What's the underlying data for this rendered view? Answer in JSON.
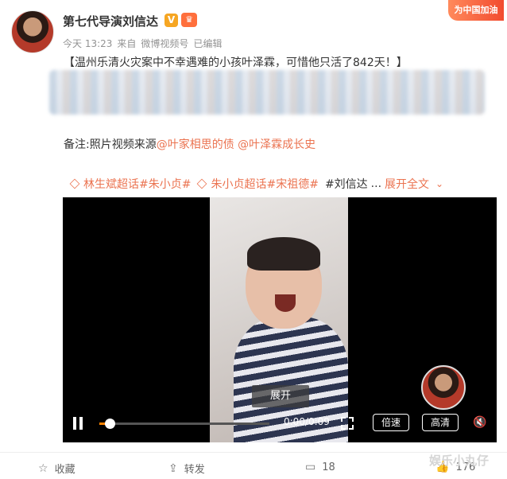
{
  "user": {
    "name": "第七代导演刘信达",
    "verified_badge": "V",
    "meta": [
      "今天 13:23",
      "来自",
      "微博视频号",
      "已编辑"
    ]
  },
  "promo_label": "为中国加油",
  "post": {
    "text": "【温州乐清火灾案中不幸遇难的小孩叶泽霖，可惜他只活了842天！】",
    "note_prefix": "备注:照片视频来源",
    "mention1": "@叶家相思的债",
    "mention2": "@叶泽霖成长史"
  },
  "tags": {
    "tag1": "林生斌超话#朱小贞#",
    "tag2": "朱小贞超话#宋祖德#",
    "tag3": "#刘信达",
    "ellipsis": "...",
    "expand": "展开全文"
  },
  "video": {
    "expand_label": "展开",
    "time": "0:00/0:09",
    "progress": 0.06,
    "speed_label": "倍速",
    "quality_label": "高清"
  },
  "footer": {
    "collect": "收藏",
    "repost": "转发",
    "comment_count": "18",
    "like_count": "176"
  },
  "watermark": "娱乐小丸仔"
}
